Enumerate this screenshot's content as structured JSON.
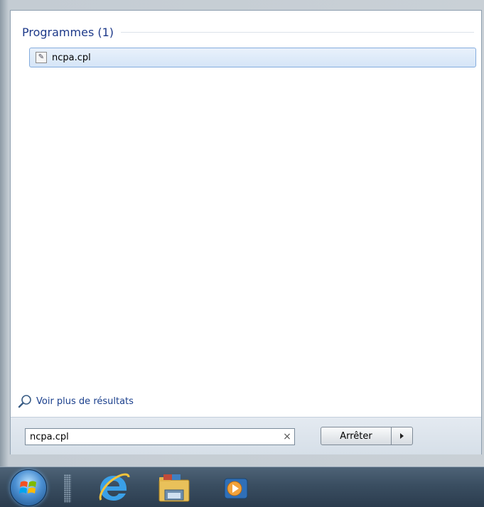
{
  "results": {
    "section_title": "Programmes (1)",
    "items": [
      {
        "label": "ncpa.cpl",
        "icon": "control-panel-file-icon"
      }
    ]
  },
  "more_results": {
    "label": "Voir plus de résultats",
    "icon": "magnifier-icon"
  },
  "search": {
    "value": "ncpa.cpl",
    "clear_glyph": "×"
  },
  "stop_button": {
    "label": "Arrêter"
  },
  "taskbar": {
    "items": [
      "start-orb",
      "internet-explorer-icon",
      "windows-explorer-icon",
      "media-player-icon"
    ]
  },
  "colors": {
    "section_title": "#1e3a8a",
    "link": "#1a3f8c",
    "selection_border": "#84acdd",
    "selection_fill": "#dce9f9",
    "taskbar": "#3a4e61"
  }
}
